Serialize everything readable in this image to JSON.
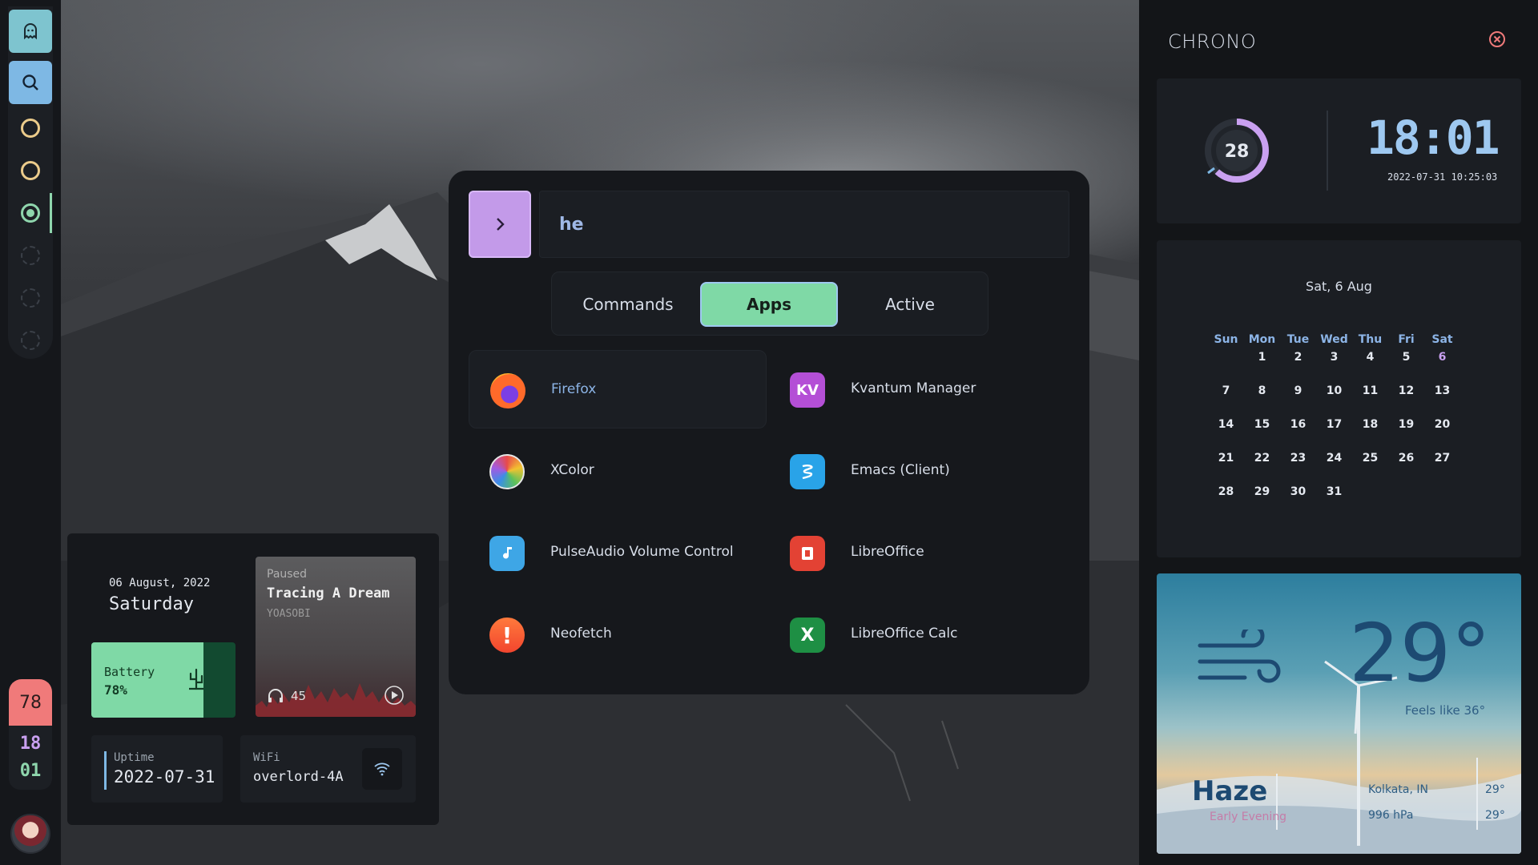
{
  "launcher": {
    "search_value": "he",
    "tabs": [
      {
        "label": "Commands",
        "active": false
      },
      {
        "label": "Apps",
        "active": true
      },
      {
        "label": "Active",
        "active": false
      }
    ],
    "apps": [
      {
        "label": "Firefox",
        "icon": "firefox-icon",
        "selected": true
      },
      {
        "label": "Kvantum Manager",
        "icon": "kvantum-icon",
        "icon_text": "KV"
      },
      {
        "label": "XColor",
        "icon": "xcolor-icon"
      },
      {
        "label": "Emacs (Client)",
        "icon": "emacs-icon"
      },
      {
        "label": "PulseAudio Volume Control",
        "icon": "pulseaudio-icon"
      },
      {
        "label": "LibreOffice",
        "icon": "libreoffice-icon"
      },
      {
        "label": "Neofetch",
        "icon": "neofetch-icon",
        "icon_text": "!"
      },
      {
        "label": "LibreOffice Calc",
        "icon": "libreoffice-calc-icon",
        "icon_text": "X"
      }
    ]
  },
  "dock": {
    "battery": "78",
    "clock_hour": "18",
    "clock_min": "01"
  },
  "widgets": {
    "date": "06 August, 2022",
    "day": "Saturday",
    "battery_label": "Battery",
    "battery_value": "78%",
    "battery_level": 0.78,
    "music_status": "Paused",
    "music_title": "Tracing A Dream",
    "music_artist": "YOASOBI",
    "music_volume": "45",
    "uptime_label": "Uptime",
    "uptime_value": "2022-07-31",
    "wifi_label": "WiFi",
    "wifi_value": "overlord-4A"
  },
  "chrono": {
    "title": "CHRONO",
    "ring_value": "28",
    "time": "18:01",
    "stamp": "2022-07-31 10:25:03",
    "calendar_header": "Sat,  6 Aug",
    "day_names": [
      "Sun",
      "Mon",
      "Tue",
      "Wed",
      "Thu",
      "Fri",
      "Sat"
    ],
    "weeks": [
      [
        "",
        "1",
        "2",
        "3",
        "4",
        "5",
        "6"
      ],
      [
        "7",
        "8",
        "9",
        "10",
        "11",
        "12",
        "13"
      ],
      [
        "14",
        "15",
        "16",
        "17",
        "18",
        "19",
        "20"
      ],
      [
        "21",
        "22",
        "23",
        "24",
        "25",
        "26",
        "27"
      ],
      [
        "28",
        "29",
        "30",
        "31",
        "",
        "",
        ""
      ]
    ],
    "today": "6"
  },
  "weather": {
    "temp": "29°",
    "feels": "Feels like 36°",
    "condition": "Haze",
    "sub": "Early Evening",
    "location": "Kolkata, IN",
    "pressure": "996 hPa",
    "high": "29°",
    "low": "29°"
  },
  "colors": {
    "accent_purple": "#c39ae9",
    "accent_green": "#7fd9a6",
    "accent_blue": "#9ec8f0",
    "alert_red": "#f07a7a"
  }
}
